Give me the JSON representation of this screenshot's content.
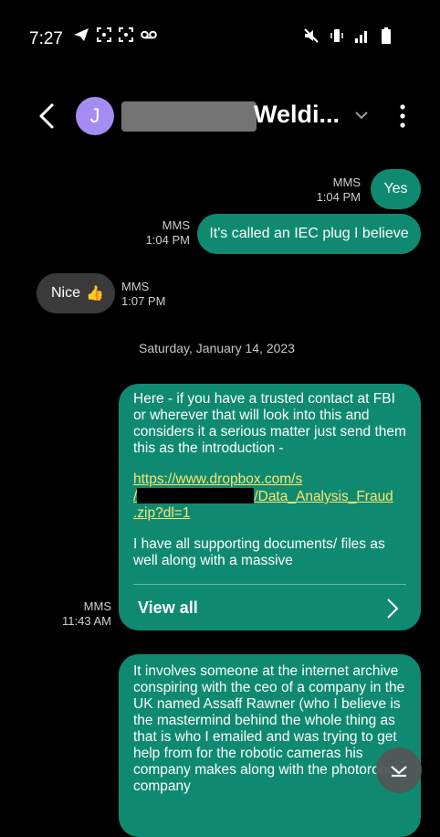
{
  "status": {
    "time": "7:27"
  },
  "header": {
    "avatar_letter": "J",
    "contact_name": "Weldi..."
  },
  "messages": {
    "yes": {
      "text": "Yes",
      "type": "MMS",
      "time": "1:04 PM"
    },
    "iec": {
      "text": "It's called an IEC plug I believe",
      "type": "MMS",
      "time": "1:04 PM"
    },
    "nice": {
      "text": "Nice",
      "emoji": "👍",
      "type": "MMS",
      "time": "1:07 PM"
    }
  },
  "date_separator": "Saturday, January 14, 2023",
  "long1": {
    "para1": "Here - if you have a trusted contact at FBI or wherever that will look into this and considers it a serious matter just send them this as the introduction -",
    "link_a": "https://www.dropbox.com/s",
    "link_b_prefix": "/",
    "link_b_suffix": "/Data_Analysis_Fraud",
    "link_c": ".zip?dl=1",
    "para2": "I have all supporting documents/ files as well along with a massive",
    "view_all": "View all",
    "type": "MMS",
    "time": "11:43 AM"
  },
  "long2": {
    "text": "It involves someone at the internet archive conspiring with the ceo of a company in the UK named Assaff Rawner (who I believe is the mastermind behind the whole thing as that is who I emailed and was trying to get help from for the robotic cameras his company makes along with the photorobot company"
  }
}
